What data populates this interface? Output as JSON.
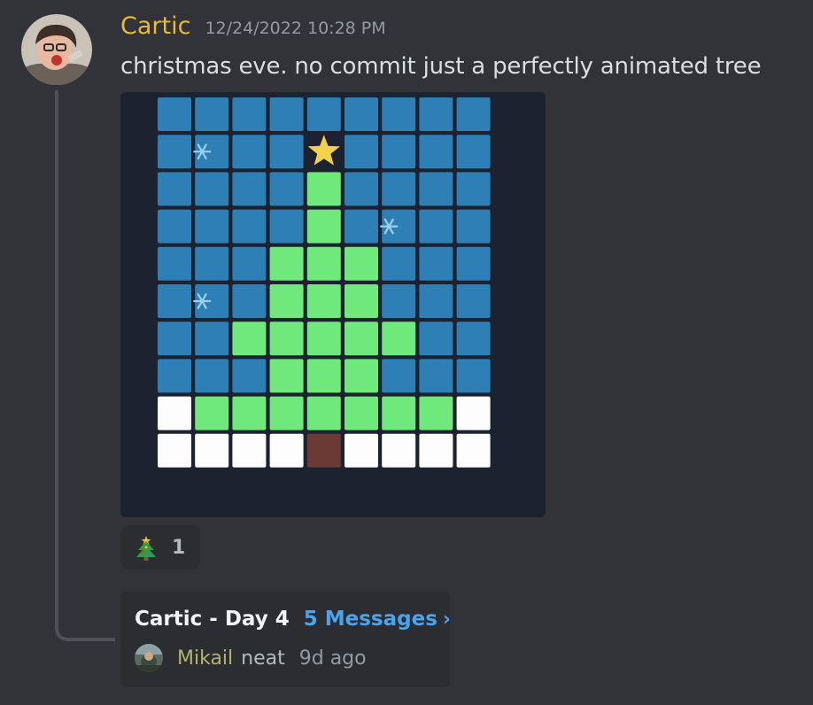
{
  "message": {
    "author": "Cartic",
    "author_color": "#e9b93d",
    "timestamp": "12/24/2022 10:28 PM",
    "text": "christmas eve. no commit just a perfectly animated tree",
    "avatar_icon": "user-avatar-icon"
  },
  "attachment": {
    "grid": {
      "rows": [
        [
          "B",
          "B",
          "B",
          "B",
          "B",
          "B",
          "B",
          "B",
          "B"
        ],
        [
          "B",
          "S",
          "B",
          "B",
          "X",
          "B",
          "B",
          "B",
          "B"
        ],
        [
          "B",
          "B",
          "B",
          "B",
          "G",
          "B",
          "B",
          "B",
          "B"
        ],
        [
          "B",
          "B",
          "B",
          "B",
          "G",
          "B",
          "F",
          "B",
          "B"
        ],
        [
          "B",
          "B",
          "B",
          "G",
          "G",
          "G",
          "B",
          "B",
          "B"
        ],
        [
          "B",
          "S",
          "B",
          "G",
          "G",
          "G",
          "B",
          "B",
          "B"
        ],
        [
          "B",
          "B",
          "G",
          "G",
          "G",
          "G",
          "G",
          "B",
          "B"
        ],
        [
          "B",
          "B",
          "B",
          "G",
          "G",
          "G",
          "B",
          "B",
          "B"
        ],
        [
          "W",
          "G",
          "G",
          "G",
          "G",
          "G",
          "G",
          "G",
          "W"
        ],
        [
          "W",
          "W",
          "W",
          "W",
          "T",
          "W",
          "W",
          "W",
          "W"
        ]
      ],
      "legend": {
        "B": "sky",
        "G": "tree",
        "W": "snow",
        "T": "trunk",
        "X": "star",
        "S": "snowflake",
        "F": "snowflake"
      }
    },
    "colors": {
      "background": "#1c2230",
      "sky": "#2d7fb5",
      "tree": "#6fe87c",
      "snow": "#fdfdfd",
      "trunk": "#6b3a35",
      "star": "#f2d24a",
      "snowflake": "#9bd0ee"
    }
  },
  "reaction": {
    "emoji_icon": "christmas-tree-emoji-icon",
    "count": "1"
  },
  "thread": {
    "name": "Cartic - Day 4",
    "message_count": "5 Messages",
    "chevron": "›",
    "last_author": "Mikail",
    "last_author_color": "#b3b36e",
    "last_text": "neat",
    "last_time": "9d ago",
    "link_color": "#4aa3ec"
  }
}
